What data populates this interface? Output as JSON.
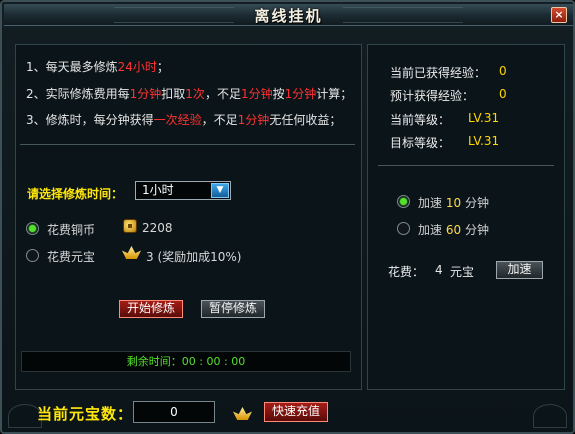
{
  "window": {
    "title": "离线挂机",
    "close_label": "×"
  },
  "rules": [
    {
      "prefix": "1、每天最多修炼",
      "highlight": "24小时",
      "suffix": "；"
    },
    {
      "line": "2、实际修炼费用每",
      "part1": "1分钟",
      "text2": "扣取",
      "part2": "1次",
      "text3": "，不足",
      "part3": "1分钟",
      "text4": "按",
      "part4": "1分钟",
      "suffix": "计算；"
    },
    {
      "prefix": "3、修炼时，每分钟获得",
      "highlight": "一次经验",
      "middle": "，不足",
      "highlight2": "1分钟",
      "suffix": "无任何收益；"
    }
  ],
  "duration": {
    "label": "请选择修炼时间：",
    "selected": "1小时"
  },
  "payment_options": [
    {
      "label": "花费铜币",
      "value": "2208",
      "selected": true,
      "icon": "copper-coin-icon"
    },
    {
      "label": "花费元宝",
      "value": "3 (奖励加成10%)",
      "selected": false,
      "icon": "gold-ingot-icon"
    }
  ],
  "actions": {
    "start": "开始修炼",
    "pause": "暂停修炼"
  },
  "remaining_time": {
    "label": "剩余时间：",
    "value": "00 : 00 : 00"
  },
  "stats": [
    {
      "label": "当前已获得经验：",
      "value": "0"
    },
    {
      "label": "预计获得经验：",
      "value": "0"
    },
    {
      "label": "当前等级：",
      "value": "LV.31"
    },
    {
      "label": "目标等级：",
      "value": "LV.31"
    }
  ],
  "speedup": {
    "options": [
      {
        "prefix": "加速",
        "amount": "10",
        "unit": "分钟",
        "selected": true
      },
      {
        "prefix": "加速",
        "amount": "60",
        "unit": "分钟",
        "selected": false
      }
    ],
    "cost_label": "花费：",
    "cost_value": "4",
    "cost_unit": "元宝",
    "button": "加速"
  },
  "footer": {
    "current_ingot_label": "当前元宝数：",
    "current_ingot_value": "0",
    "recharge_button": "快速充值"
  },
  "colors": {
    "highlight_red": "#ff3131",
    "highlight_yellow": "#ffde00",
    "accent_green": "#58dd22"
  }
}
